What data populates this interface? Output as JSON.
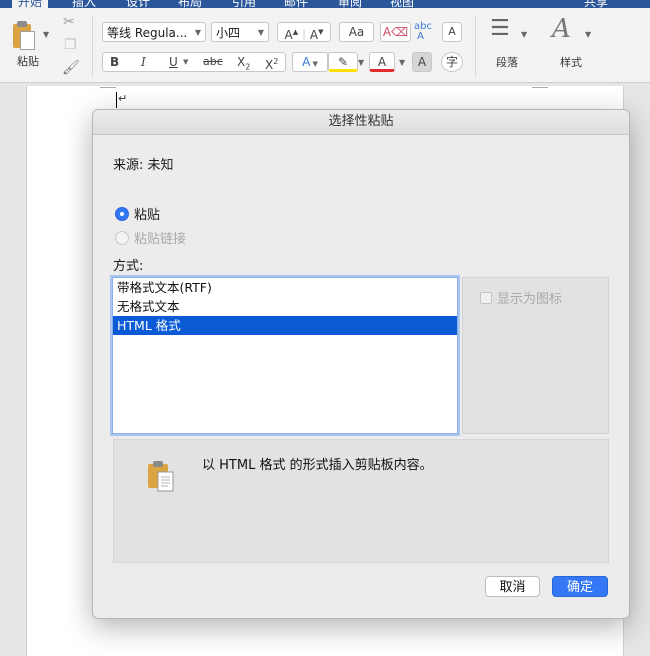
{
  "ribbon": {
    "tabs": [
      "开始",
      "插入",
      "设计",
      "布局",
      "引用",
      "邮件",
      "审阅",
      "视图"
    ],
    "share_label": "共享",
    "paste_label": "粘贴",
    "font_name": "等线 Regula...",
    "font_size": "小四",
    "paragraph_label": "段落",
    "styles_label": "样式",
    "accent_color": "#2b579a"
  },
  "document": {
    "return_mark": "↵"
  },
  "dialog": {
    "title": "选择性粘贴",
    "source": "来源:  未知",
    "radio_paste": "粘贴",
    "radio_paste_link": "粘贴链接",
    "method_label": "方式:",
    "formats": [
      "带格式文本(RTF)",
      "无格式文本",
      "HTML 格式"
    ],
    "selected_format": "HTML 格式",
    "display_as_icon": "显示为图标",
    "result_text": "以 HTML 格式 的形式插入剪贴板内容。",
    "cancel_label": "取消",
    "ok_label": "确定",
    "accent_color": "#3478f6"
  }
}
